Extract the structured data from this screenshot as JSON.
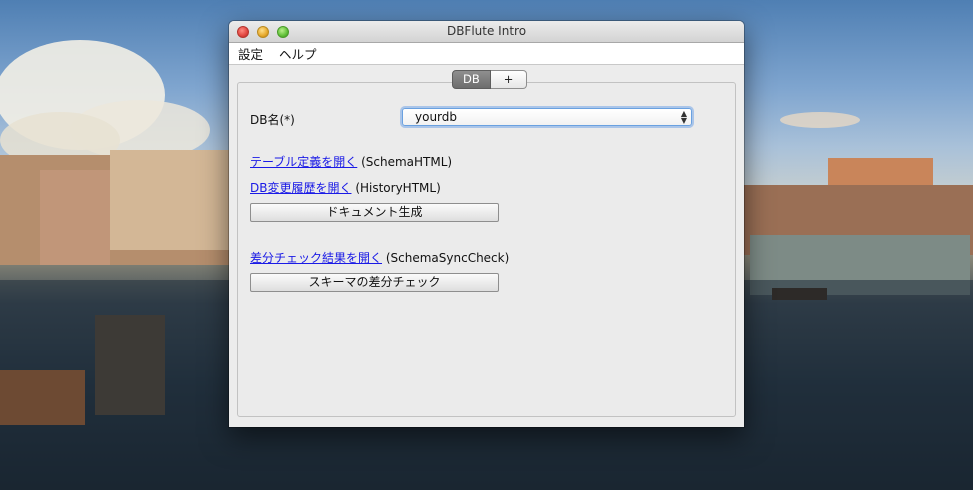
{
  "window": {
    "title": "DBFlute Intro"
  },
  "menubar": {
    "items": [
      "設定",
      "ヘルプ"
    ]
  },
  "tabs": [
    {
      "label": "DB",
      "active": true
    },
    {
      "label": "+"
    }
  ],
  "form": {
    "db_name_label": "DB名(*)",
    "db_select_value": "yourdb"
  },
  "links": {
    "schema_html_link": "テーブル定義を開く",
    "schema_html_suffix": "(SchemaHTML)",
    "history_html_link": "DB変更履歴を開く",
    "history_html_suffix": "(HistoryHTML)",
    "schema_sync_link": "差分チェック結果を開く",
    "schema_sync_suffix": "(SchemaSyncCheck)"
  },
  "buttons": {
    "generate_docs": "ドキュメント生成",
    "schema_sync_check": "スキーマの差分チェック"
  },
  "icons": {
    "select_arrows": "up-down-chevron-icon"
  },
  "colors": {
    "link": "#1a1ae6",
    "focus_ring": "#6aa1e0"
  }
}
